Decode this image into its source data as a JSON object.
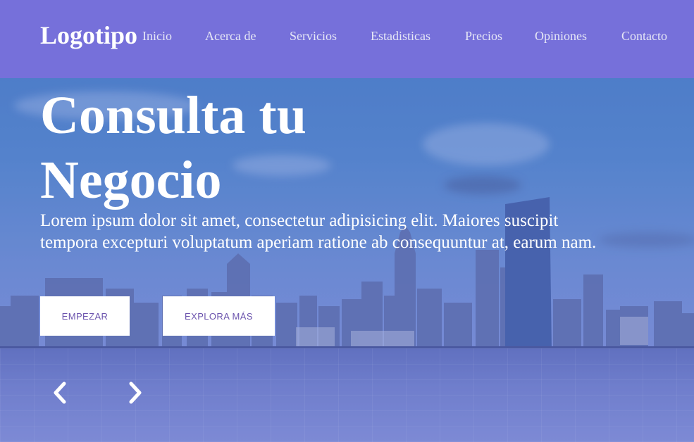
{
  "header": {
    "logo": "Logotipo",
    "nav": [
      {
        "label": "Inicio"
      },
      {
        "label": "Acerca de"
      },
      {
        "label": "Servicios"
      },
      {
        "label": "Estadisticas"
      },
      {
        "label": "Precios"
      },
      {
        "label": "Opiniones"
      },
      {
        "label": "Contacto"
      }
    ]
  },
  "hero": {
    "title": "Consulta tu Negocio",
    "description": "Lorem ipsum dolor sit amet, consectetur adipisicing elit. Maiores suscipit tempora excepturi voluptatum aperiam ratione ab consequuntur at, earum nam.",
    "primary_button": "EMPEZAR",
    "secondary_button": "EXPLORA MÁS"
  },
  "slider": {
    "prev_icon": "chevron-left-icon",
    "next_icon": "chevron-right-icon"
  },
  "colors": {
    "navbar": "#7670da",
    "button_text": "#6b53ad",
    "text": "#ffffff"
  }
}
